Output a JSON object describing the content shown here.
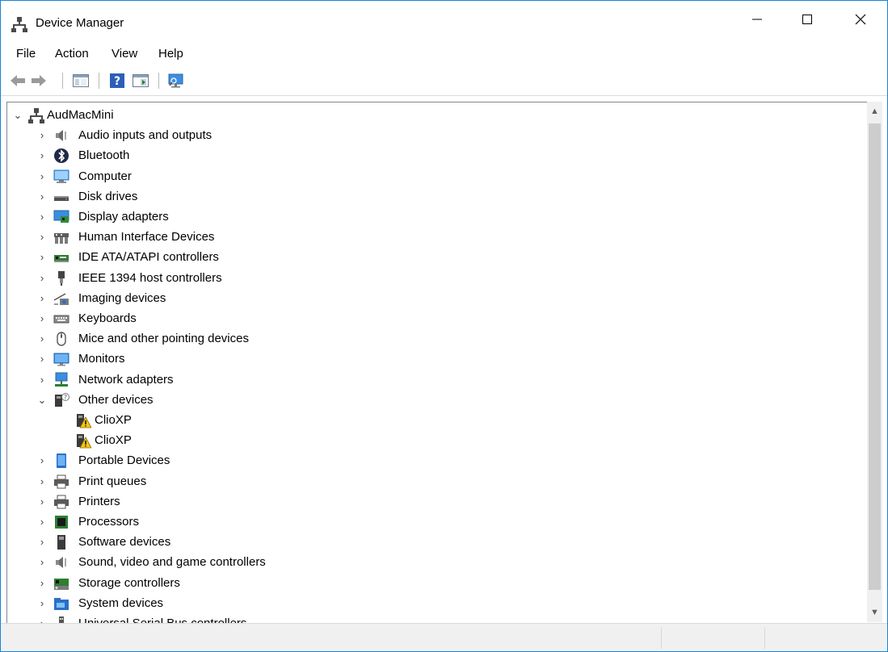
{
  "window": {
    "title": "Device Manager"
  },
  "menu": [
    "File",
    "Action",
    "View",
    "Help"
  ],
  "tree": {
    "root": "AudMacMini",
    "categories": [
      {
        "label": "Audio inputs and outputs",
        "icon": "speaker-icon"
      },
      {
        "label": "Bluetooth",
        "icon": "bluetooth-icon"
      },
      {
        "label": "Computer",
        "icon": "computer-icon"
      },
      {
        "label": "Disk drives",
        "icon": "disk-icon"
      },
      {
        "label": "Display adapters",
        "icon": "display-adapter-icon"
      },
      {
        "label": "Human Interface Devices",
        "icon": "hid-icon"
      },
      {
        "label": "IDE ATA/ATAPI controllers",
        "icon": "ide-icon"
      },
      {
        "label": "IEEE 1394 host controllers",
        "icon": "firewire-icon"
      },
      {
        "label": "Imaging devices",
        "icon": "camera-icon"
      },
      {
        "label": "Keyboards",
        "icon": "keyboard-icon"
      },
      {
        "label": "Mice and other pointing devices",
        "icon": "mouse-icon"
      },
      {
        "label": "Monitors",
        "icon": "monitor-icon"
      },
      {
        "label": "Network adapters",
        "icon": "network-icon"
      },
      {
        "label": "Other devices",
        "icon": "unknown-device-icon",
        "expanded": true,
        "children": [
          {
            "label": "ClioXP",
            "icon": "warning-device-icon"
          },
          {
            "label": "ClioXP",
            "icon": "warning-device-icon"
          }
        ]
      },
      {
        "label": "Portable Devices",
        "icon": "portable-device-icon"
      },
      {
        "label": "Print queues",
        "icon": "print-queue-icon"
      },
      {
        "label": "Printers",
        "icon": "printer-icon"
      },
      {
        "label": "Processors",
        "icon": "processor-icon"
      },
      {
        "label": "Software devices",
        "icon": "software-device-icon"
      },
      {
        "label": "Sound, video and game controllers",
        "icon": "speaker-icon"
      },
      {
        "label": "Storage controllers",
        "icon": "storage-controller-icon"
      },
      {
        "label": "System devices",
        "icon": "system-folder-icon"
      },
      {
        "label": "Universal Serial Bus controllers",
        "icon": "usb-icon"
      }
    ]
  },
  "colors": {
    "accent": "#1883d7",
    "selection": "#cce8ff"
  }
}
